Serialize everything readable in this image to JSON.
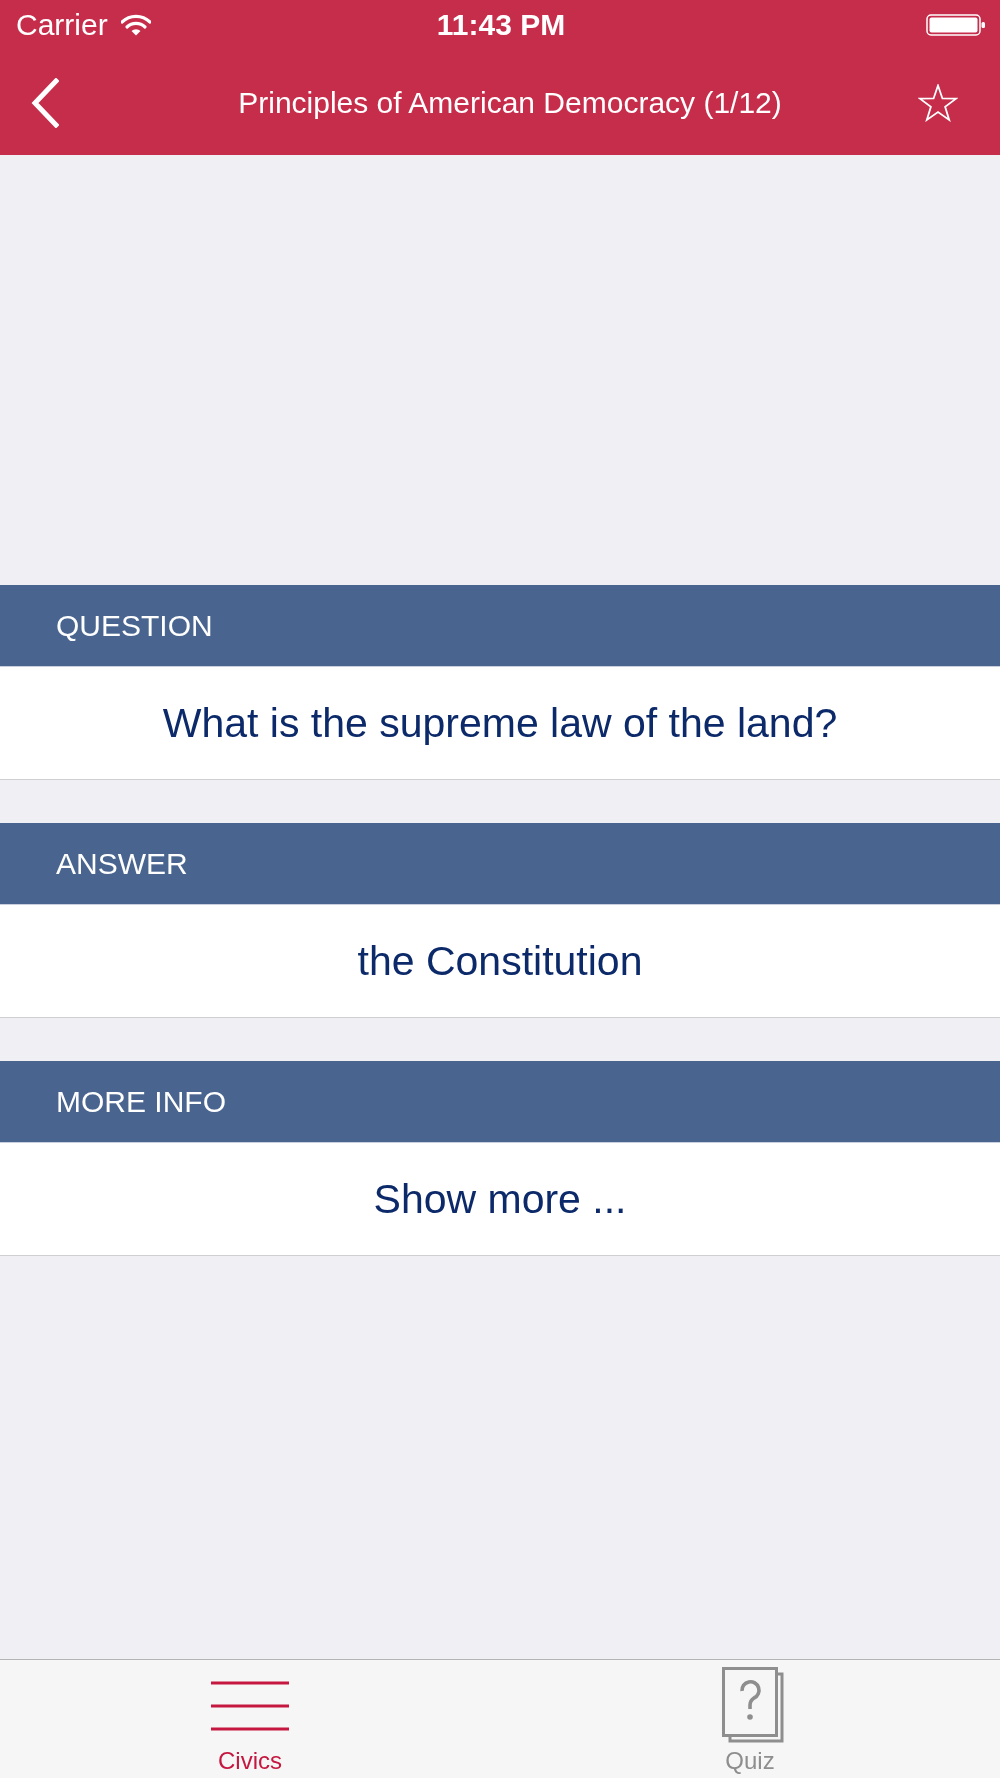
{
  "status_bar": {
    "carrier": "Carrier",
    "time": "11:43 PM"
  },
  "nav_bar": {
    "title": "Principles of American Democracy (1/12)",
    "favorite": false
  },
  "sections": [
    {
      "header": "QUESTION",
      "body": "What is the supreme law of the land?"
    },
    {
      "header": "ANSWER",
      "body": "the Constitution"
    },
    {
      "header": "MORE INFO",
      "body": "Show more ..."
    }
  ],
  "tab_bar": [
    {
      "label": "Civics",
      "kind": "list",
      "selected": true
    },
    {
      "label": "Quiz",
      "kind": "quiz",
      "selected": false
    }
  ]
}
